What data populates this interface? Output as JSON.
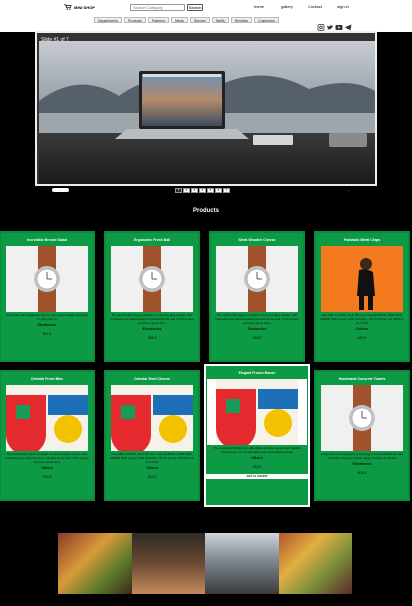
{
  "header": {
    "brand": "MINI SHOP",
    "search_placeholder": "Search Category",
    "search_button": "Search",
    "nav": [
      "home",
      "gallery",
      "Contact",
      "sign in"
    ],
    "categories": [
      "Departments",
      "Products",
      "Partners",
      "News",
      "Service",
      "Tariffs",
      "Reviews",
      "Customers"
    ],
    "social_icons": [
      "instagram-icon",
      "twitter-icon",
      "youtube-icon",
      "telegram-icon"
    ]
  },
  "carousel": {
    "label": "Slide #1 of 7",
    "pages": [
      "1",
      "2",
      "3",
      "4",
      "5",
      "6",
      "7"
    ],
    "active_page": 0,
    "prev_label": "‹",
    "next_label": "›"
  },
  "products_title": "Products",
  "products": [
    {
      "name": "Incredible Bronze Salad",
      "desc": "Carbonite web goalkeeper gloves are ergonomically designed to give easy fit",
      "category": "Electronics",
      "price": "551 €",
      "image": "watch"
    },
    {
      "name": "Ergonomic Fresh Ball",
      "desc": "The automobile layout consists of a front-engine design, with transaxle-type transmissions mounted at the rear of the engine and four wheel drive",
      "category": "Electronics",
      "price": "455 €",
      "image": "watch"
    },
    {
      "name": "Sleek Wooden Cheese",
      "desc": "The automobile layout consists of a front-engine design, with transaxle-type transmissions mounted at the rear of the engine and four wheel drive",
      "category": "Electronics",
      "price": "935 €",
      "image": "watch"
    },
    {
      "name": "Fantastic Metal Chips",
      "desc": "New ABC 13 9370, 13.3, 5th Gen CoreA5-8250U, 8GB RAM, 256GB SSD, power UHD Graphics, OS 10 Home, OS Office A & J 2016",
      "category": "Clothes",
      "price": "439 €",
      "image": "girl"
    },
    {
      "name": "Oriental Fresh Bike",
      "desc": "The automobile layout consists of a front-engine design, with transaxle-type transmissions mounted at the rear of the engine and four wheel drive",
      "category": "Others",
      "price": "953 €",
      "image": "book"
    },
    {
      "name": "Oriental Steel Cheese",
      "desc": "New ABC 13 9370, 13.3, 5th Gen CoreA5-8250U, 8GB RAM, 256GB SSD, power UHD Graphics, OS 10 Home, OS Office A & J 2016",
      "category": "Others",
      "price": "363 €",
      "image": "book"
    },
    {
      "name": "Elegant Frozen Bacon",
      "desc": "The Apollotech B340 is an affordable wireless mouse with reliable connectivity, 12 months battery life and modern design",
      "category": "Others",
      "price": "182 €",
      "image": "book",
      "button": "add to basket"
    },
    {
      "name": "Handmade Concrete Towels",
      "desc": "Andy shoes are designed to keeping in mind durability as well as trends, the most stylish range of shoes & sandals",
      "category": "Electronics",
      "price": "806 €",
      "image": "watch"
    }
  ],
  "colors": {
    "card": "#0d9a44",
    "background": "#000000"
  }
}
